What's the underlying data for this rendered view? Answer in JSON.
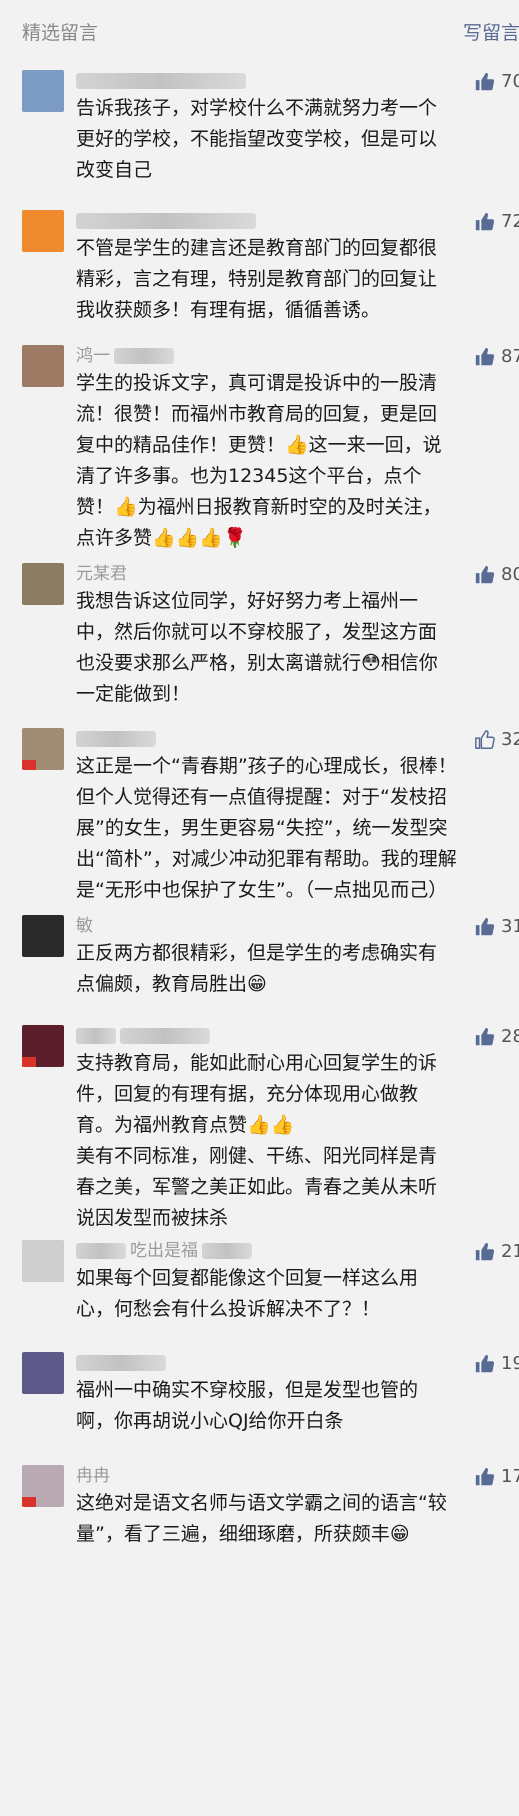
{
  "header": {
    "title": "精选留言",
    "write_label": "写留言"
  },
  "colors": {
    "thumb_filled": "#576b95",
    "thumb_outline": "#576b95",
    "link": "#576b95"
  },
  "comments": [
    {
      "nickname": "",
      "likes": "70",
      "liked": true,
      "avatar_color": "#7b9bc4",
      "lines": [
        "告诉我孩子，对学校什么不满就努力考一个",
        "更好的学校，不能指望改变学校，但是可以",
        "改变自己"
      ]
    },
    {
      "nickname": "",
      "likes": "72",
      "liked": true,
      "avatar_color": "#f08a2e",
      "lines": [
        "不管是学生的建言还是教育部门的回复都很",
        "精彩，言之有理，特别是教育部门的回复让",
        "我收获颇多！有理有据，循循善诱。"
      ]
    },
    {
      "nickname": "鸿一",
      "likes": "87",
      "liked": true,
      "avatar_color": "#9c7a64",
      "lines": [
        "学生的投诉文字，真可谓是投诉中的一股清",
        "流！很赞！而福州市教育局的回复，更是回",
        "复中的精品佳作！更赞！👍这一来一回，说",
        "清了许多事。也为12345这个平台，点个",
        "赞！👍为福州日报教育新时空的及时关注，",
        "点许多赞👍👍👍🌹"
      ]
    },
    {
      "nickname": "元某君",
      "likes": "80",
      "liked": true,
      "avatar_color": "#8a7d63",
      "lines": [
        "我想告诉这位同学，好好努力考上福州一",
        "中，然后你就可以不穿校服了，发型这方面",
        "也没要求那么严格，别太离谱就行😳相信你",
        "一定能做到！"
      ]
    },
    {
      "nickname": "",
      "likes": "32",
      "liked": false,
      "avatar_color": "#a08b73",
      "flag": true,
      "lines": [
        "这正是一个“青春期”孩子的心理成长，很棒！",
        "但个人觉得还有一点值得提醒：对于“发枝招",
        "展”的女生，男生更容易“失控”，统一发型突",
        "出“简朴”，对减少冲动犯罪有帮助。我的理解",
        "是“无形中也保护了女生”。（一点拙见而己）"
      ]
    },
    {
      "nickname": "敏",
      "likes": "31",
      "liked": true,
      "avatar_color": "#2a2a2a",
      "lines": [
        "正反两方都很精彩，但是学生的考虑确实有",
        "点偏颇，教育局胜出😁"
      ]
    },
    {
      "nickname": "",
      "likes": "28",
      "liked": true,
      "avatar_color": "#5a1f2a",
      "flag": true,
      "lines": [
        "支持教育局，能如此耐心用心回复学生的诉",
        "件，回复的有理有据，充分体现用心做教",
        "育。为福州教育点赞👍👍",
        "美有不同标准，刚健、干练、阳光同样是青",
        "春之美，军警之美正如此。青春之美从未听",
        "说因发型而被抹杀"
      ]
    },
    {
      "nickname": "吃出是福",
      "likes": "21",
      "liked": true,
      "avatar_color": "#cfcfcf",
      "lines": [
        "如果每个回复都能像这个回复一样这么用",
        "心，何愁会有什么投诉解决不了？！"
      ]
    },
    {
      "nickname": "",
      "likes": "19",
      "liked": true,
      "avatar_color": "#5d5a8a",
      "lines": [
        "福州一中确实不穿校服，但是发型也管的",
        "啊，你再胡说小心QJ给你开白条"
      ]
    },
    {
      "nickname": "冉冉",
      "likes": "17",
      "liked": true,
      "avatar_color": "#b9a9b3",
      "flag": true,
      "lines": [
        "这绝对是语文名师与语文学霸之间的语言“较",
        "量”，看了三遍，细细琢磨，所获颇丰😁"
      ]
    }
  ]
}
